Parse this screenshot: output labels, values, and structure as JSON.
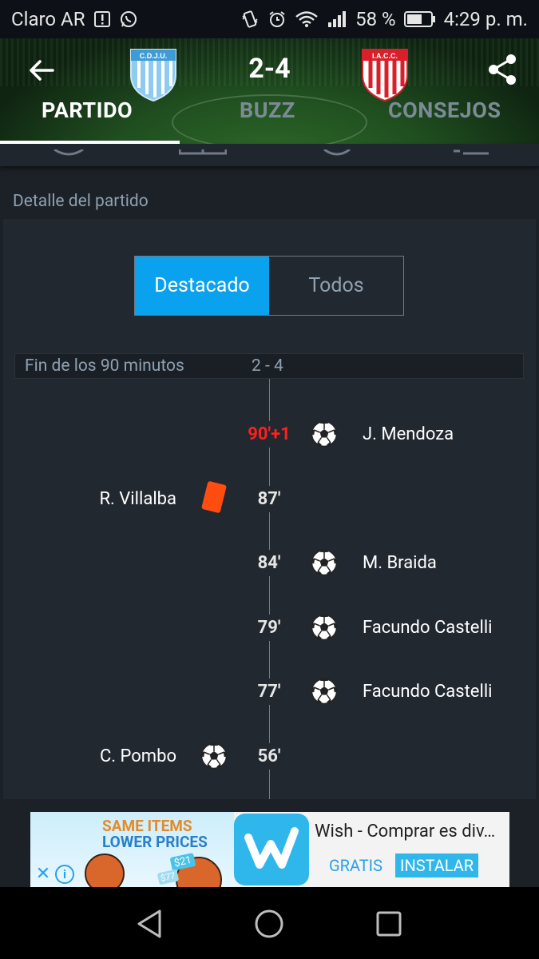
{
  "status_bar": {
    "carrier": "Claro AR",
    "battery": "58 %",
    "time": "4:29 p. m."
  },
  "match": {
    "score": "2-4",
    "home_crest_text": "C.D.J.U.",
    "away_crest_text": "I.A.C.C."
  },
  "tabs": [
    {
      "label": "PARTIDO",
      "active": true
    },
    {
      "label": "BUZZ",
      "active": false
    },
    {
      "label": "CONSEJOS",
      "active": false
    }
  ],
  "section_title": "Detalle del partido",
  "segmented": {
    "highlight_label": "Destacado",
    "all_label": "Todos"
  },
  "period": {
    "label": "Fin de los 90 minutos",
    "score": "2 - 4"
  },
  "events": [
    {
      "minute": "90'+1",
      "side": "away",
      "type": "goal",
      "player": "J. Mendoza",
      "minute_color": "red"
    },
    {
      "minute": "87'",
      "side": "home",
      "type": "red-card",
      "player": "R. Villalba"
    },
    {
      "minute": "84'",
      "side": "away",
      "type": "goal",
      "player": "M. Braida"
    },
    {
      "minute": "79'",
      "side": "away",
      "type": "goal",
      "player": "Facundo Castelli"
    },
    {
      "minute": "77'",
      "side": "away",
      "type": "goal",
      "player": "Facundo Castelli"
    },
    {
      "minute": "56'",
      "side": "home",
      "type": "goal",
      "player": "C. Pombo"
    }
  ],
  "ad": {
    "line1": "SAME ITEMS",
    "line2": "LOWER PRICES",
    "tag1": "$21",
    "tag2": "$77",
    "title": "Wish - Comprar es div…",
    "gratis": "GRATIS",
    "install": "INSTALAR"
  },
  "colors": {
    "accent": "#0aa2ee",
    "red_minute": "#ff1f1f",
    "red_card": "#ff4d12",
    "background": "#1c2127"
  }
}
